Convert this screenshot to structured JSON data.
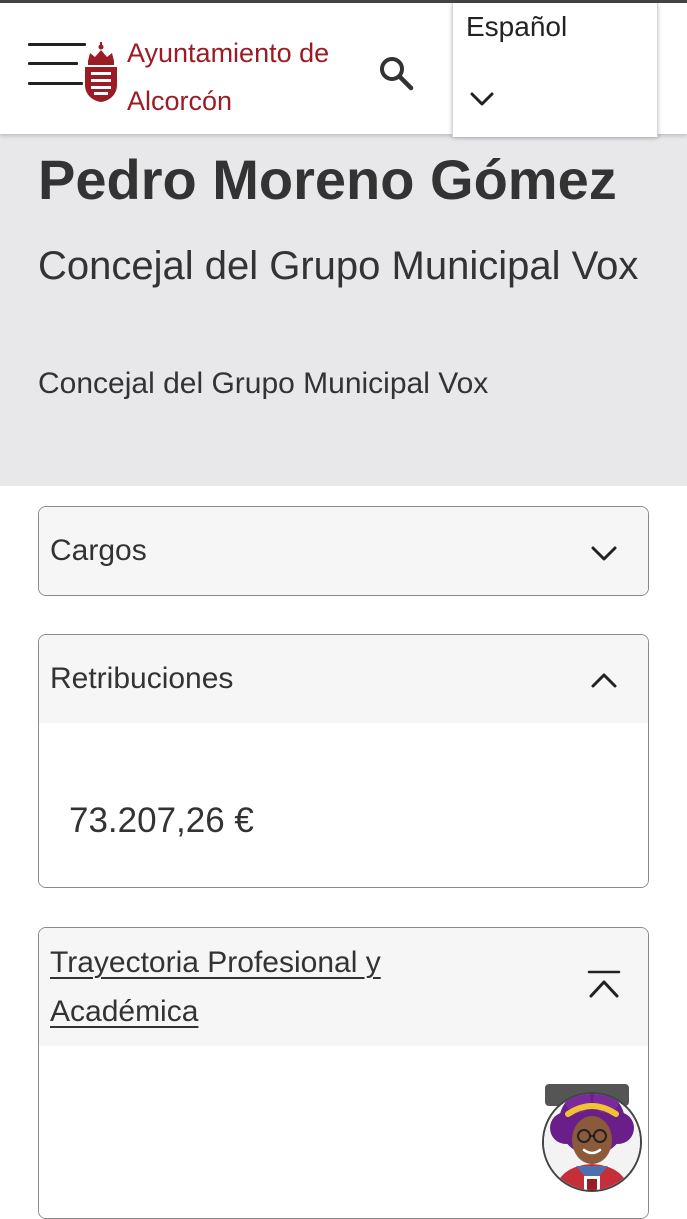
{
  "header": {
    "menu_icon": "hamburger-menu-icon",
    "crest_icon": "municipal-crest-icon",
    "brand_line1": "Ayuntamiento de",
    "brand_line2": "Alcorcón",
    "search_icon": "search-icon",
    "language": {
      "selected": "Español",
      "chevron_icon": "chevron-down-icon"
    }
  },
  "profile": {
    "name": "Pedro Moreno Gómez",
    "role_heading": "Concejal del Grupo Municipal Vox",
    "role_subheading": "Concejal del Grupo Municipal Vox"
  },
  "sections": {
    "cargos": {
      "title": "Cargos",
      "expanded": false
    },
    "retribuciones": {
      "title": "Retribuciones",
      "expanded": true,
      "amount": "73.207,26 €"
    },
    "trayectoria": {
      "title_line1": "Trayectoria Profesional y",
      "title_line2": "Académica",
      "expanded": true
    }
  },
  "assistant": {
    "icon": "virtual-assistant-avatar-icon"
  },
  "colors": {
    "brand": "#9b1c24",
    "hero_background": "#e8e8eb",
    "text": "#333333",
    "accordion_border": "#8a8a8a",
    "accordion_header": "#f6f6f6"
  }
}
